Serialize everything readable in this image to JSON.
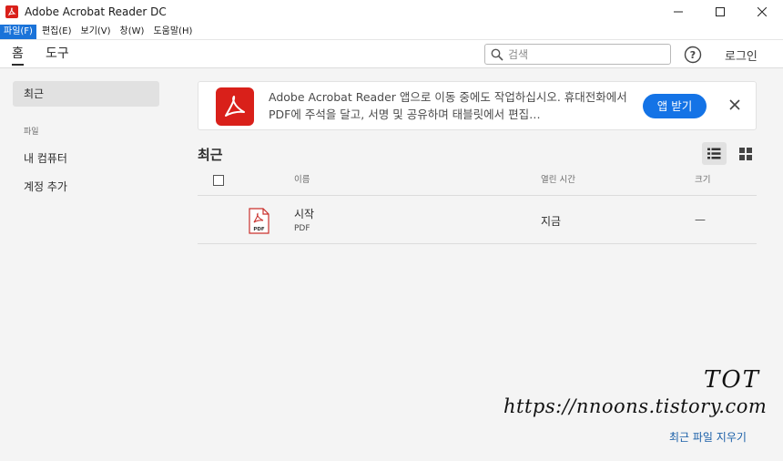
{
  "window": {
    "title": "Adobe Acrobat Reader DC",
    "controls": [
      "minimize-icon",
      "maximize-icon",
      "close-icon"
    ]
  },
  "menu": [
    {
      "label": "파일(F)",
      "active": true
    },
    {
      "label": "편집(E)",
      "active": false
    },
    {
      "label": "보기(V)",
      "active": false
    },
    {
      "label": "창(W)",
      "active": false
    },
    {
      "label": "도움말(H)",
      "active": false
    }
  ],
  "tabs": {
    "home": "홈",
    "tools": "도구"
  },
  "search": {
    "placeholder": "검색",
    "icon": "search-icon"
  },
  "header": {
    "help_icon": "help-icon",
    "login": "로그인"
  },
  "sidebar": {
    "recent": "최근",
    "files_section": "파일",
    "my_computer": "내 컴퓨터",
    "add_account": "계정 추가"
  },
  "banner": {
    "text": "Adobe Acrobat Reader 앱으로 이동 중에도 작업하십시오. 휴대전화에서 PDF에 주석을 달고, 서명 및 공유하며 태블릿에서 편집…",
    "button": "앱 받기",
    "close_icon": "close-icon"
  },
  "recent": {
    "title": "최근",
    "view_list_icon": "list-view-icon",
    "view_grid_icon": "grid-view-icon",
    "columns": {
      "name": "이름",
      "opened": "열린 시간",
      "size": "크기"
    },
    "files": [
      {
        "name": "시작",
        "type": "PDF",
        "opened": "지금",
        "size": "—"
      }
    ]
  },
  "watermark": {
    "line1": "TOT",
    "line2": "https://nnoons.tistory.com"
  },
  "footer": {
    "clear_recent": "최근 파일 지우기"
  },
  "colors": {
    "brand_red": "#d9201a",
    "accent_blue": "#1473e6",
    "menu_active": "#1a73d9",
    "link": "#1a5fa8"
  }
}
